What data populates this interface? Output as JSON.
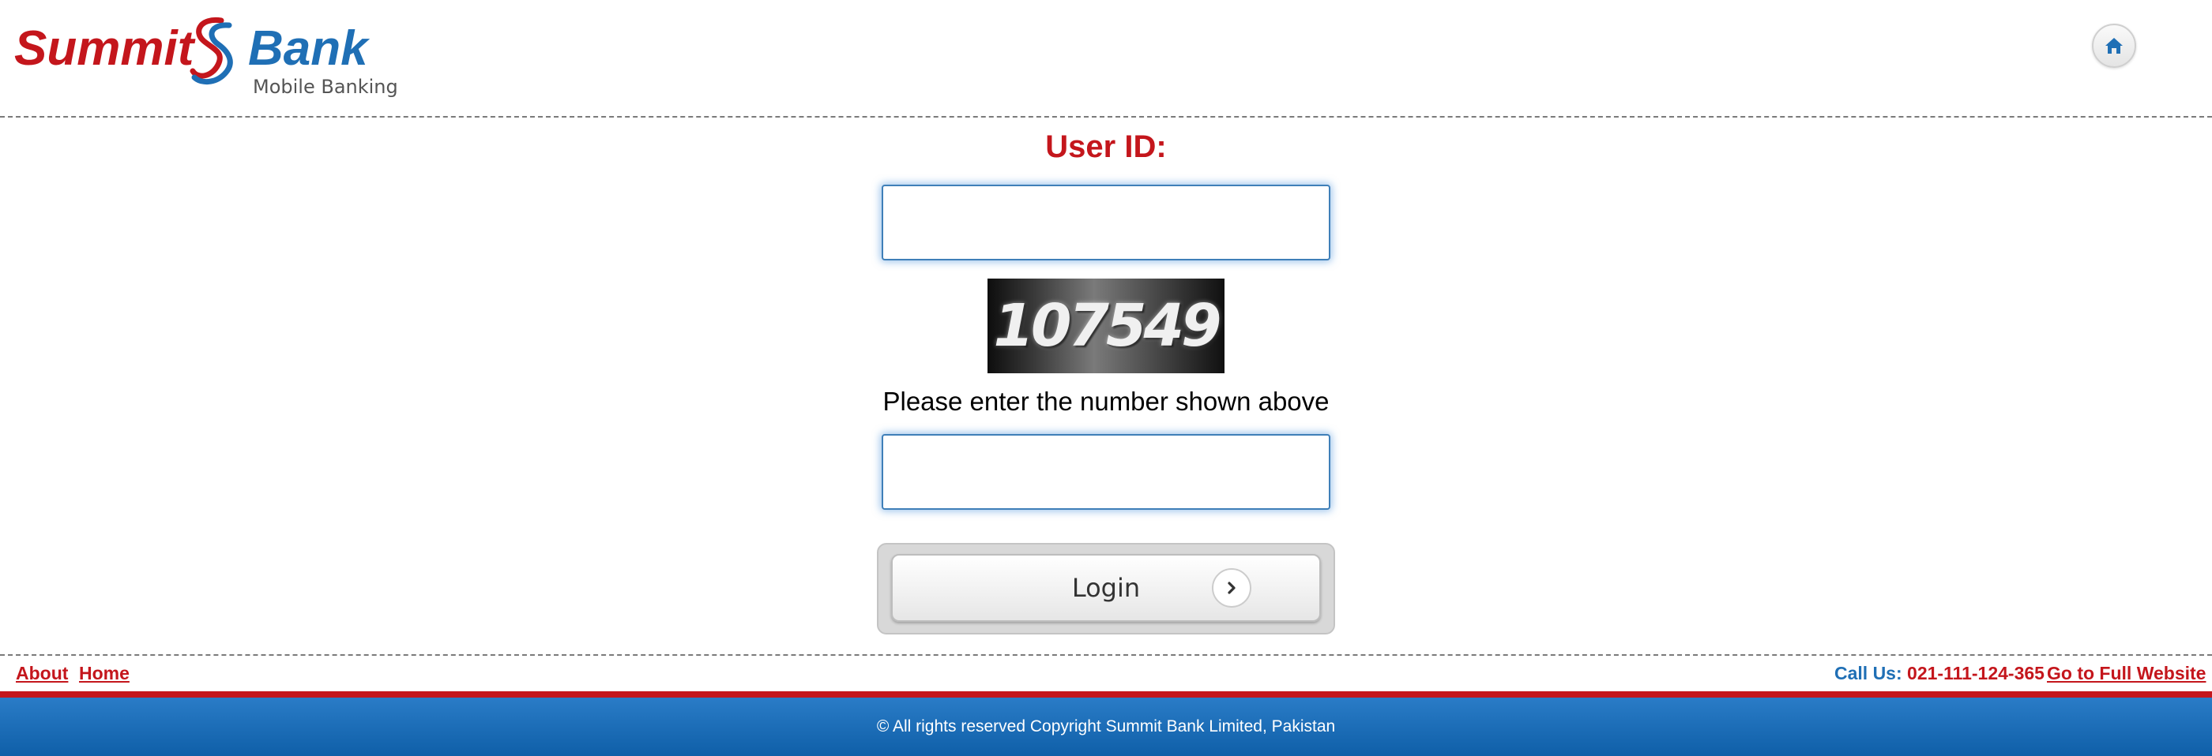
{
  "header": {
    "logo": {
      "brand_word1": "Summit",
      "brand_word2": "Bank",
      "tagline": "Mobile Banking"
    },
    "home_icon": "home-icon"
  },
  "form": {
    "userid_label": "User ID:",
    "userid_value": "",
    "captcha_text": "107549",
    "captcha_hint": "Please enter the number shown above",
    "captcha_value": "",
    "login_label": "Login",
    "login_icon": "chevron-right-icon"
  },
  "footer": {
    "links": {
      "about": "About",
      "home": "Home"
    },
    "call_label": "Call Us:",
    "call_number": "021-111-124-365",
    "full_website": "Go to Full Website",
    "copyright": "© All rights reserved Copyright Summit Bank Limited, Pakistan"
  },
  "colors": {
    "brand_red": "#c4161c",
    "brand_blue": "#1f6fb5",
    "input_border": "#3f7fb8"
  }
}
